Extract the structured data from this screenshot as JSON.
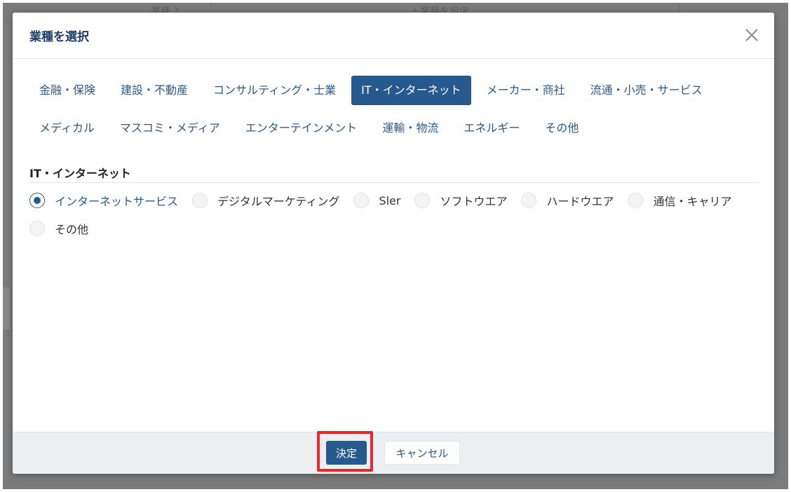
{
  "background": {
    "faint_left": "業種 ?",
    "faint_right": "＋業種を設定"
  },
  "modal": {
    "title": "業種を選択",
    "close_icon": "close-icon"
  },
  "tabs": {
    "row1": [
      {
        "label": "金融・保険",
        "active": false
      },
      {
        "label": "建設・不動産",
        "active": false
      },
      {
        "label": "コンサルティング・士業",
        "active": false
      },
      {
        "label": "IT・インターネット",
        "active": true
      },
      {
        "label": "メーカー・商社",
        "active": false
      },
      {
        "label": "流通・小売・サービス",
        "active": false
      }
    ],
    "row2": [
      {
        "label": "メディカル",
        "active": false
      },
      {
        "label": "マスコミ・メディア",
        "active": false
      },
      {
        "label": "エンターテインメント",
        "active": false
      },
      {
        "label": "運輸・物流",
        "active": false
      },
      {
        "label": "エネルギー",
        "active": false
      },
      {
        "label": "その他",
        "active": false
      }
    ]
  },
  "section": {
    "title": "IT・インターネット",
    "options": [
      {
        "label": "インターネットサービス",
        "checked": true
      },
      {
        "label": "デジタルマーケティング",
        "checked": false
      },
      {
        "label": "Sler",
        "checked": false
      },
      {
        "label": "ソフトウエア",
        "checked": false
      },
      {
        "label": "ハードウエア",
        "checked": false
      },
      {
        "label": "通信・キャリア",
        "checked": false
      },
      {
        "label": "その他",
        "checked": false
      }
    ]
  },
  "footer": {
    "ok_label": "決定",
    "cancel_label": "キャンセル"
  },
  "colors": {
    "accent": "#265a8f",
    "link": "#2a5a8c",
    "highlight": "#e5282a",
    "footer_bg": "#eceff2"
  }
}
